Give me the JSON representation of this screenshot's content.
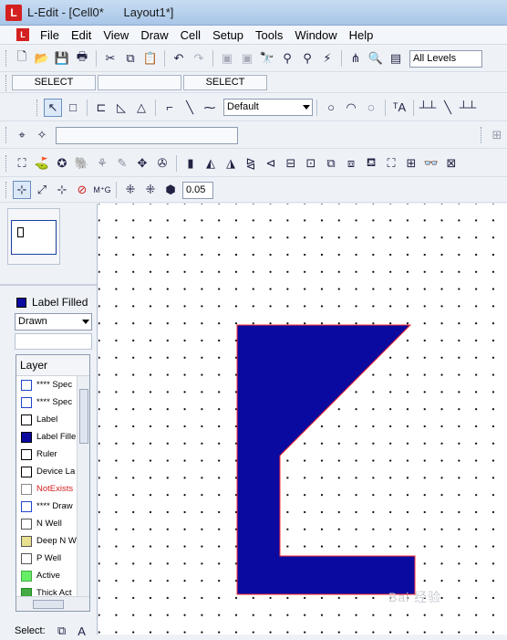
{
  "window": {
    "title": "L-Edit - [Cell0*      Layout1*]",
    "app_icon": "L"
  },
  "menu": [
    "File",
    "Edit",
    "View",
    "Draw",
    "Cell",
    "Setup",
    "Tools",
    "Window",
    "Help"
  ],
  "toolbar1": {
    "icons": [
      "new-file-icon",
      "open-folder-icon",
      "save-icon",
      "print-icon",
      "cut-icon",
      "copy-icon",
      "paste-icon",
      "undo-icon",
      "redo-icon",
      "cell-a-icon",
      "cell-b-icon",
      "find-icon",
      "find-next-icon",
      "replace-icon",
      "probe-icon",
      "hierarchy-icon",
      "zoom-icon",
      "layer-palette-icon"
    ],
    "levels_value": "All Levels"
  },
  "toolbar2": {
    "left_status": "SELECT",
    "right_status": "SELECT"
  },
  "toolbar3": {
    "style_value": "Default"
  },
  "toolbar4": {
    "blank": ""
  },
  "toolbar6": {
    "grid_value": "0.05"
  },
  "panel": {
    "current_layer": "Label Filled",
    "draw_mode": "Drawn",
    "layers_header": "Layer",
    "layers": [
      {
        "name": "**** Spec",
        "color": "#ffffff",
        "border": "#2244cc"
      },
      {
        "name": "**** Spec",
        "color": "#ffffff",
        "border": "#2244cc"
      },
      {
        "name": "Label",
        "color": "#ffffff",
        "border": "#000000"
      },
      {
        "name": "Label Fille",
        "color": "#0a0aa0",
        "border": "#000000"
      },
      {
        "name": "Ruler",
        "color": "#ffffff",
        "border": "#000000"
      },
      {
        "name": "Device La",
        "color": "#ffffff",
        "border": "#000000"
      },
      {
        "name": "NotExists",
        "color": "#ffffff",
        "border": "#888888",
        "text_color": "#d42020"
      },
      {
        "name": "**** Draw",
        "color": "#ffffff",
        "border": "#2244cc"
      },
      {
        "name": "N Well",
        "color": "#ffffff",
        "border": "#555555"
      },
      {
        "name": "Deep N W",
        "color": "#e8e090",
        "border": "#555555"
      },
      {
        "name": "P Well",
        "color": "#ffffff",
        "border": "#555555"
      },
      {
        "name": "Active",
        "color": "#66ee66",
        "border": "#44aa44"
      },
      {
        "name": "Thick Act",
        "color": "#44aa44",
        "border": "#228822"
      }
    ],
    "select_label": "Select:"
  },
  "watermark": "Bai 经验"
}
